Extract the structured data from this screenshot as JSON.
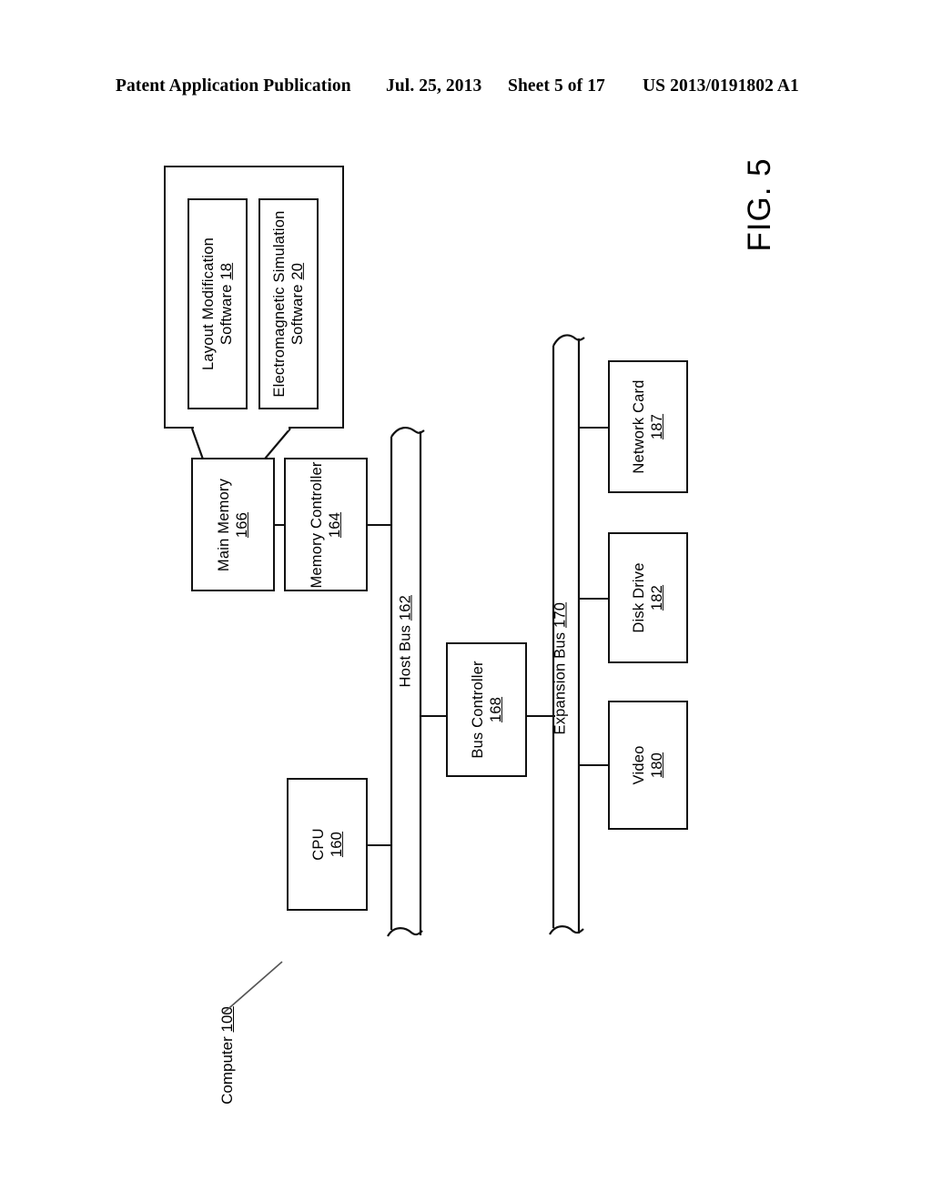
{
  "page_header": {
    "publication": "Patent Application Publication",
    "date": "Jul. 25, 2013",
    "sheet": "Sheet 5 of 17",
    "patent_number": "US 2013/0191802 A1"
  },
  "figure": {
    "label": "FIG. 5",
    "system_label": "Computer",
    "system_number": "100"
  },
  "blocks": {
    "layout_modification_software": {
      "line1": "Layout Modification",
      "line2": "Software",
      "number": "18"
    },
    "electromagnetic_simulation_software": {
      "line1": "Electromagnetic Simulation",
      "line2": "Software",
      "number": "20"
    },
    "main_memory": {
      "line1": "Main Memory",
      "number": "166"
    },
    "memory_controller": {
      "line1": "Memory Controller",
      "number": "164"
    },
    "cpu": {
      "line1": "CPU",
      "number": "160"
    },
    "bus_controller": {
      "line1": "Bus Controller",
      "number": "168"
    },
    "network_card": {
      "line1": "Network Card",
      "number": "187"
    },
    "disk_drive": {
      "line1": "Disk Drive",
      "number": "182"
    },
    "video": {
      "line1": "Video",
      "number": "180"
    }
  },
  "buses": {
    "host_bus": {
      "label": "Host Bus",
      "number": "162"
    },
    "expansion_bus": {
      "label": "Expansion Bus",
      "number": "170"
    }
  },
  "colors": {
    "ink": "#111111",
    "paper": "#ffffff"
  }
}
